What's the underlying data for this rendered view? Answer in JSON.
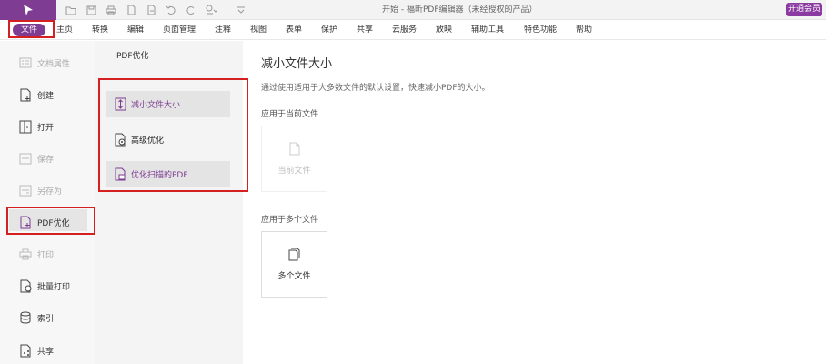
{
  "titlebar": {
    "title": "开始 - 福昕PDF编辑器（未经授权的产品）",
    "vip_button": "开通会员",
    "accent": "#7e3c92"
  },
  "menubar": {
    "file_tab": "文件",
    "items": [
      "主页",
      "转换",
      "编辑",
      "页面管理",
      "注释",
      "视图",
      "表单",
      "保护",
      "共享",
      "云服务",
      "放映",
      "辅助工具",
      "特色功能",
      "帮助"
    ]
  },
  "sidebar": {
    "items": [
      {
        "label": "文档属性",
        "icon": "document-properties-icon",
        "disabled": true
      },
      {
        "label": "创建",
        "icon": "create-icon",
        "disabled": false
      },
      {
        "label": "打开",
        "icon": "open-icon",
        "disabled": false
      },
      {
        "label": "保存",
        "icon": "save-icon",
        "disabled": true
      },
      {
        "label": "另存为",
        "icon": "save-as-icon",
        "disabled": true
      },
      {
        "label": "PDF优化",
        "icon": "pdf-optimize-icon",
        "disabled": false,
        "selected": true
      },
      {
        "label": "打印",
        "icon": "print-icon",
        "disabled": true
      },
      {
        "label": "批量打印",
        "icon": "batch-print-icon",
        "disabled": false
      },
      {
        "label": "索引",
        "icon": "index-icon",
        "disabled": false
      },
      {
        "label": "共享",
        "icon": "share-icon",
        "disabled": false
      }
    ]
  },
  "midpanel": {
    "title": "PDF优化",
    "items": [
      {
        "label": "减小文件大小",
        "icon": "reduce-size-icon",
        "selected": true
      },
      {
        "label": "高级优化",
        "icon": "advanced-optimize-icon",
        "selected": false
      },
      {
        "label": "优化扫描的PDF",
        "icon": "optimize-scanned-icon",
        "selected": false
      }
    ]
  },
  "main": {
    "title": "减小文件大小",
    "description": "通过使用适用于大多数文件的默认设置，快速减小PDF的大小。",
    "current_section": "应用于当前文件",
    "current_card": "当前文件",
    "multi_section": "应用于多个文件",
    "multi_card": "多个文件"
  }
}
